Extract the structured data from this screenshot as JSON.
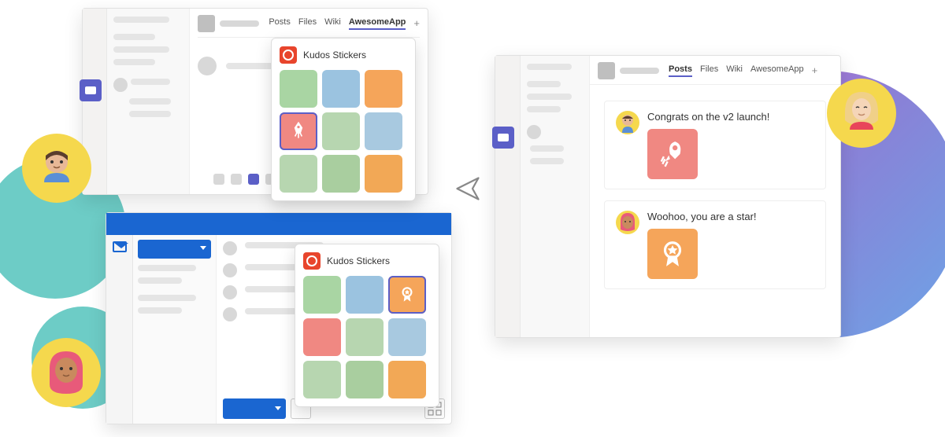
{
  "tabs": {
    "posts": "Posts",
    "files": "Files",
    "wiki": "Wiki",
    "app": "AwesomeApp"
  },
  "sticker_popup": {
    "title": "Kudos Stickers"
  },
  "messages": {
    "msg1": "Congrats on the v2 launch!",
    "msg2": "Woohoo, you are a star!"
  },
  "icons": {
    "rocket": "rocket-icon",
    "award": "award-icon",
    "send": "send-icon",
    "mail": "mail-icon",
    "apps": "apps-icon"
  }
}
